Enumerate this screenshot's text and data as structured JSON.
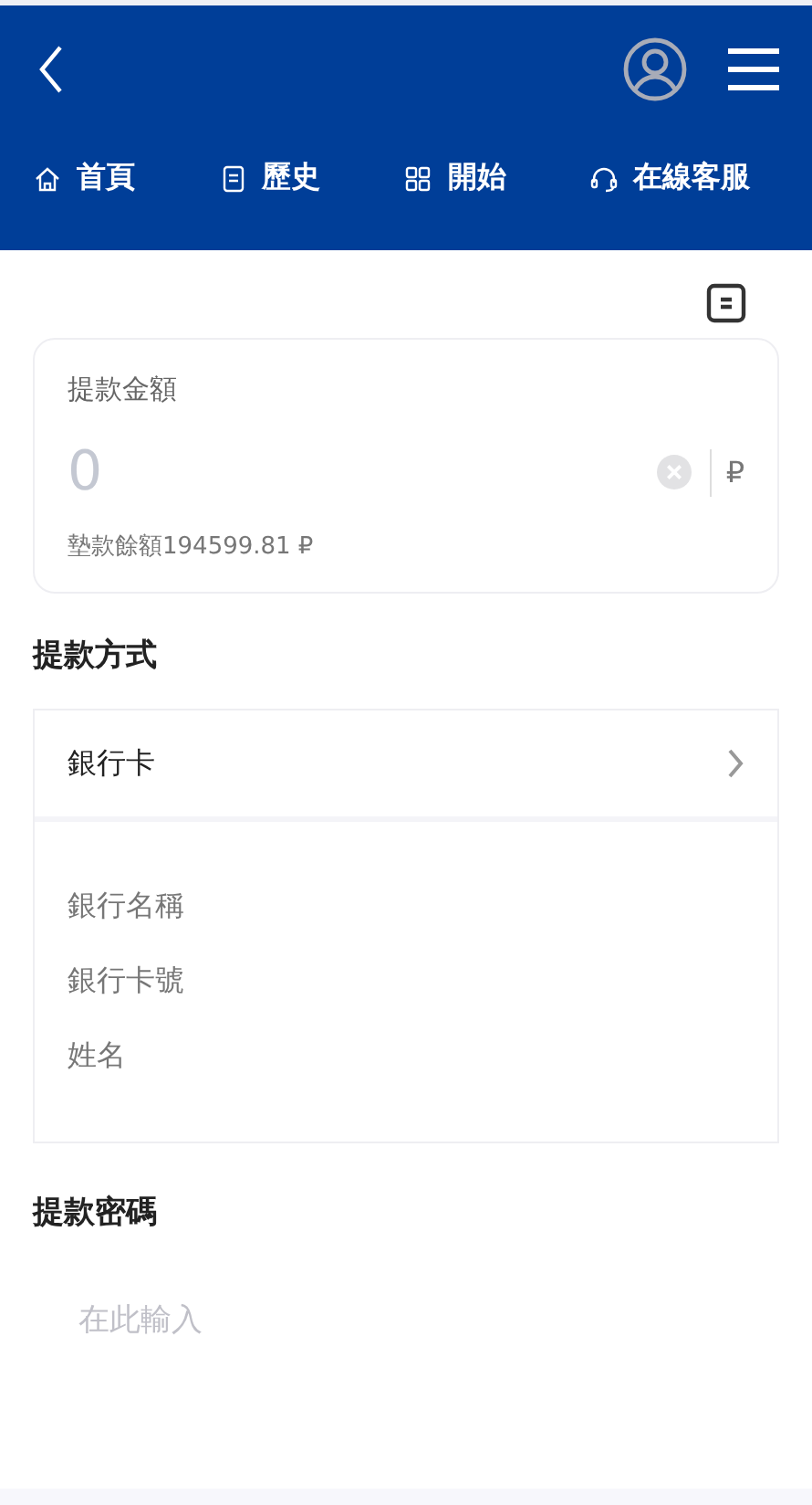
{
  "nav": [
    {
      "kind": "home",
      "label": "首頁"
    },
    {
      "kind": "history",
      "label": "歷史"
    },
    {
      "kind": "start",
      "label": "開始"
    },
    {
      "kind": "support",
      "label": "在線客服"
    }
  ],
  "amount": {
    "label": "提款金額",
    "placeholder": "0",
    "currency": "₽",
    "balance": "墊款餘額194599.81 ₽"
  },
  "method": {
    "title": "提款方式",
    "selected": "銀行卡",
    "fields": [
      "銀行名稱",
      "銀行卡號",
      "姓名"
    ]
  },
  "password": {
    "title": "提款密碼",
    "placeholder": "在此輸入"
  }
}
